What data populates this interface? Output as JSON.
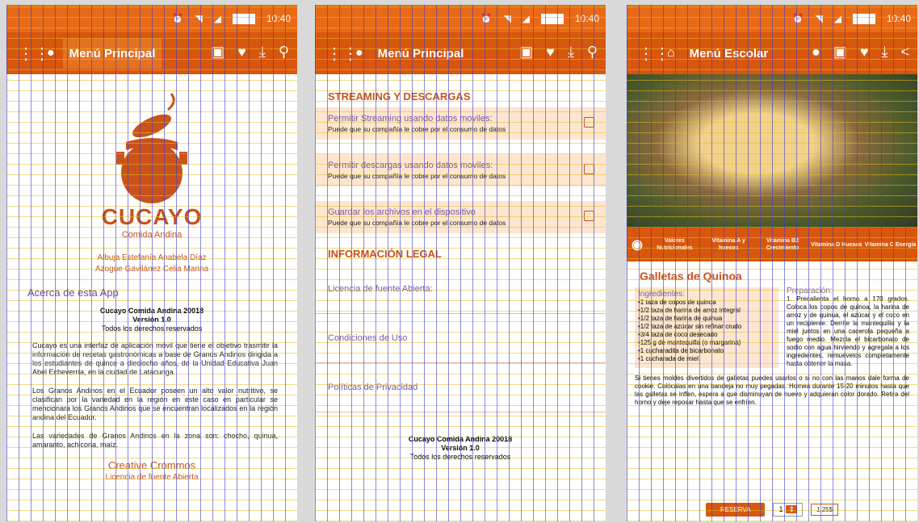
{
  "status": {
    "time": "10:40"
  },
  "screen1": {
    "menu_title": "Menú Principal",
    "brand_title": "CUCAYO",
    "brand_sub": "Comida Andina",
    "authors": [
      "Albuja Estefanía Anabela Díaz",
      "Azogue Gavilánez Celia Marina"
    ],
    "about_heading": "Acerca de esta App",
    "app_name": "Cucayo Comida Andina 20018",
    "version": "Versión 1.0",
    "rights": "Todos los derechos reservados",
    "paragraphs": [
      "Cucayo es una interfaz de aplicación móvil que tiene el objetivo trasmitir la información de recetas gastronómicas a base de Granos Andinos dirigida a los estudiantes de quince a dieciocho años, de la Unidad Educativa Juan Abel Echeverría, en la ciudad de Latacunga.",
      "Los Granos Andinos en el Ecuador poseen un alto valor nutritivo, se clasifican por la variedad en la región en este caso en particular se mencionara los Granos Andinos que se encuentran localizados en la región andina del Ecuador.",
      "Las variedades de Granos Andinos en la zona son: chocho, quinua, amaranto, achicoria, maíz."
    ],
    "creative": "Creative Crommos",
    "license": "Licencia de fuente Abierta"
  },
  "screen2": {
    "menu_title": "Menú Principal",
    "streaming_heading": "STREAMING Y DESCARGAS",
    "settings": [
      {
        "title": "Permitir Streaming usando datos moviles:",
        "sub": "Puede que su compañía le cobre por el consumo de datos"
      },
      {
        "title": "Permitir descargas usando datos moviles:",
        "sub": "Puede que su compañía le cobre por el consumo de datos"
      },
      {
        "title": "Guardar los archivos en el dispositivo",
        "sub": "Puede que su compañía le cobre por el consumo de datos"
      }
    ],
    "legal_heading": "INFORMACIÓN LEGAL",
    "legal_items": [
      "Licencia de fuente Abierta:",
      "Condiciones de Uso",
      "Políticas de Privacidad"
    ],
    "app_name": "Cucayo Comida Andina 20018",
    "version": "Versión 1.0",
    "rights": "Todos los derechos reservados"
  },
  "screen3": {
    "menu_title": "Menú Escolar",
    "vitamins": [
      "Valores Nutricionales",
      "Vitamina A y huesos",
      "Vitamina B2 Crecimiento",
      "Vitamina D Huesos",
      "Vitamina C Energía"
    ],
    "recipe_title": "Galletas de Quinoa",
    "ingredients_label": "Ingredientes:",
    "ingredients": [
      "•1 taza de copos de quinoa",
      "•1/2 taza de harina de arroz integral",
      "•1/2 taza de harina de quinua",
      "•1/2 taza de azúcar sin refinar crudo",
      "•3/4 taza de coco desecado",
      "•125 g de mantequilla (o margarina)",
      "•1 cucharadita de bicarbonato",
      "•1 cucharada de miel"
    ],
    "prep_label": "Preparación:",
    "prep_text": "1. Precalienta el horno a 170 grados. Coloca los copos de quinoa, la harina de arroz y de quinua, el azúcar y el coco en un recipiente. Derrite la mantequilla y la miel juntos en una cacerola pequeña a fuego medio. Mezcla el bicarbonato de sodio con agua hirviendo y agregala a los ingredientes, remuévelos completamente hasta obtener la masa.",
    "tip_text": "Si tienes moldes divertidos de galletas puedes usarlos o si no con las manos dale forma de cookie. Colócalas en una bandeja no muy pegadas. Hornea durante 15-20 minutos hasta que las galletas se inflen, espera a que disminuyan de nuevo y adquieran color dorado. Retira del horno y deje reposar hasta que se enfríen.",
    "reserve_label": "RESERVA",
    "qty": "1",
    "price": "1,25$"
  }
}
